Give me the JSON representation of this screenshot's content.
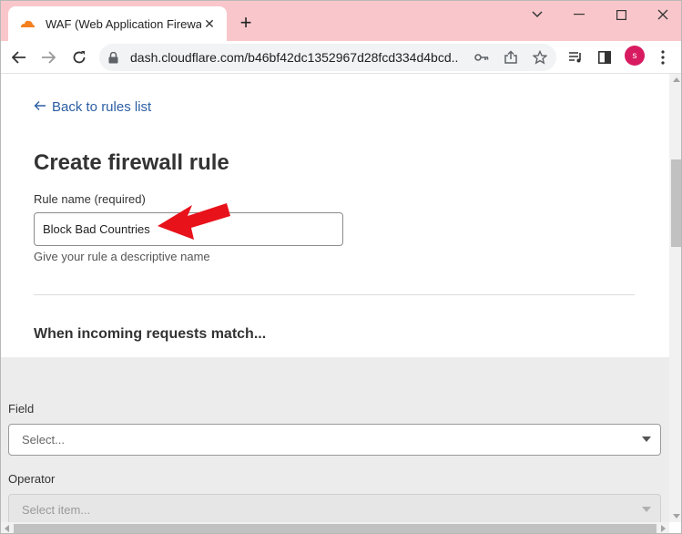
{
  "browser": {
    "tab_title": "WAF (Web Application Firewall) |",
    "url": "dash.cloudflare.com/b46bf42dc1352967d28fcd334d4bcd...",
    "profile_initial": "s",
    "window_controls": [
      "chevron-down-icon",
      "minimize-icon",
      "maximize-icon",
      "close-icon"
    ],
    "colors": {
      "tabstrip": "#f9c7cb",
      "avatar": "#d81b60",
      "favicon": "#f48120"
    }
  },
  "page": {
    "back_link": "Back to rules list",
    "heading": "Create firewall rule",
    "rule_name_label": "Rule name (required)",
    "rule_name_value": "Block Bad Countries",
    "rule_name_helper": "Give your rule a descriptive name",
    "section_heading": "When incoming requests match...",
    "field_label": "Field",
    "field_placeholder": "Select...",
    "operator_label": "Operator",
    "operator_placeholder": "Select item...",
    "colors": {
      "link": "#2c5fa4",
      "annotation_arrow": "#e8121b"
    }
  }
}
